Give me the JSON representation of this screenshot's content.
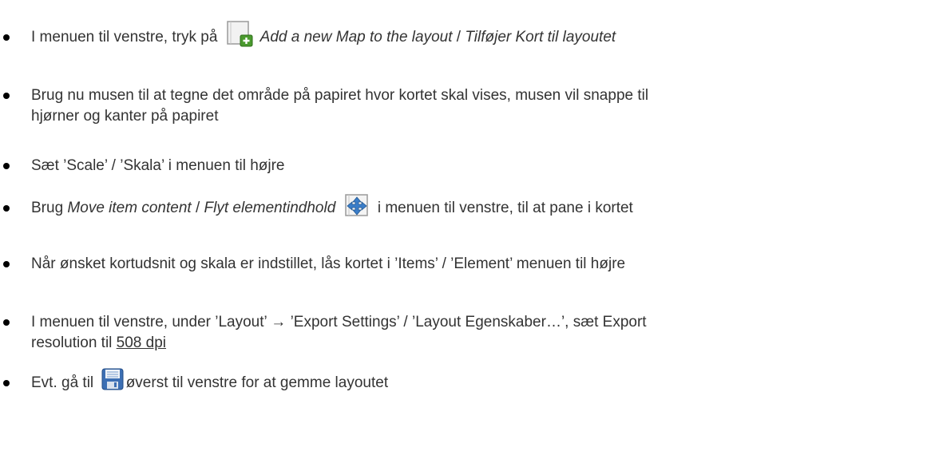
{
  "items": [
    {
      "t1": "I menuen til venstre, tryk på",
      "t2": "Add a new Map to the layout",
      "t3": " / ",
      "t4": "Tilføjer Kort til layoutet",
      "icon": "add-map-icon"
    },
    {
      "line1": "Brug nu musen til at tegne det område på papiret hvor kortet skal vises, musen vil snappe til",
      "line2": "hjørner og kanter på papiret"
    },
    {
      "text": "Sæt ’Scale’ / ’Skala’ i menuen til højre"
    },
    {
      "t1": "Brug ",
      "t2": "Move item content",
      "t3": " / ",
      "t4": "Flyt elementindhold",
      "t5": " i menuen til venstre, til at pane i kortet",
      "icon": "move-item-content-icon"
    },
    {
      "text": "Når ønsket kortudsnit og skala er indstillet, lås kortet i ’Items’ / ’Element’ menuen til højre"
    },
    {
      "line1": "I menuen til venstre, under ’Layout’ → ’Export Settings’ / ’Layout Egenskaber…’, sæt Export",
      "line2a": "resolution til ",
      "line2b": "508 dpi"
    },
    {
      "t1": "Evt. gå til ",
      "t2": "øverst til venstre for at gemme layoutet",
      "icon": "save-icon"
    }
  ]
}
